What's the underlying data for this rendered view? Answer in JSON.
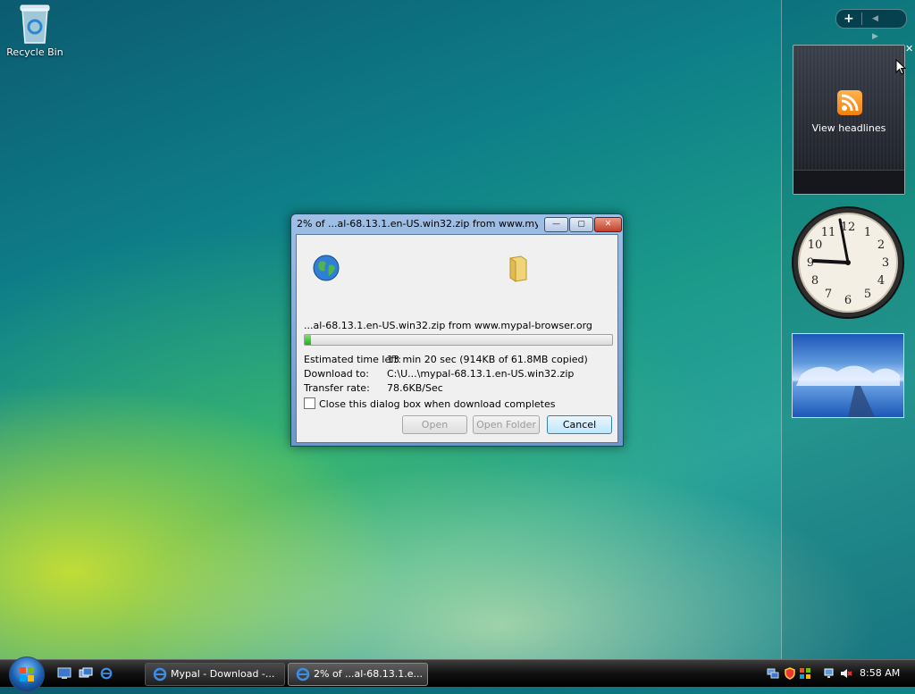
{
  "desktop": {
    "recycle_bin_label": "Recycle Bin"
  },
  "sidebar": {
    "add_button": "+",
    "nav_arrows": "◀ ▶",
    "feed_gadget_label": "View headlines",
    "close_glyph": "✕"
  },
  "dialog": {
    "title": "2% of ...al-68.13.1.en-US.win32.zip from www.my...",
    "file_line": "...al-68.13.1.en-US.win32.zip from www.mypal-browser.org",
    "progress_percent": 2,
    "rows": [
      {
        "label": "Estimated time left:",
        "value": "13 min 20 sec (914KB of 61.8MB copied)"
      },
      {
        "label": "Download to:",
        "value": "C:\\U...\\mypal-68.13.1.en-US.win32.zip"
      },
      {
        "label": "Transfer rate:",
        "value": "78.6KB/Sec"
      }
    ],
    "checkbox_label": "Close this dialog box when download completes",
    "checkbox_checked": false,
    "buttons": {
      "open": "Open",
      "open_folder": "Open Folder",
      "cancel": "Cancel"
    },
    "titlebar": {
      "minimize": "—",
      "maximize": "▢",
      "close": "✕"
    }
  },
  "taskbar": {
    "tasks": [
      {
        "label": "Mypal - Download -...",
        "active": false
      },
      {
        "label": "2% of ...al-68.13.1.e...",
        "active": true
      }
    ],
    "clock": "8:58 AM"
  },
  "colors": {
    "progress_green": "#1fb212",
    "rss_orange": "#f27f0c"
  }
}
